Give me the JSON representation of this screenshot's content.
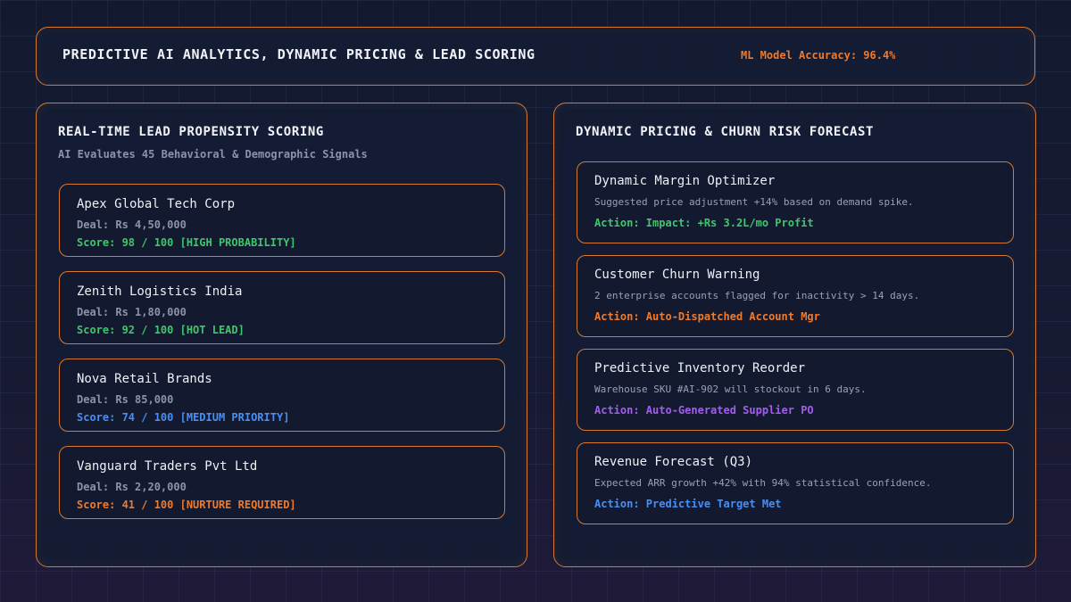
{
  "header": {
    "title": "PREDICTIVE AI ANALYTICS, DYNAMIC PRICING & LEAD SCORING",
    "metric": "ML Model Accuracy: 96.4%",
    "metric_color": "#f07a2a"
  },
  "leads": {
    "title": "REAL-TIME LEAD PROPENSITY SCORING",
    "subtitle": "AI Evaluates 45 Behavioral & Demographic Signals",
    "items": [
      {
        "name": "Apex Global Tech Corp",
        "deal": "Deal: Rs 4,50,000",
        "score": "Score: 98 / 100 [HIGH PROBABILITY]",
        "color": "#3fc66b"
      },
      {
        "name": "Zenith Logistics India",
        "deal": "Deal: Rs 1,80,000",
        "score": "Score: 92 / 100 [HOT LEAD]",
        "color": "#3fc66b"
      },
      {
        "name": "Nova Retail Brands",
        "deal": "Deal: Rs 85,000",
        "score": "Score: 74 / 100 [MEDIUM PRIORITY]",
        "color": "#4a8ef0"
      },
      {
        "name": "Vanguard Traders Pvt Ltd",
        "deal": "Deal: Rs 2,20,000",
        "score": "Score: 41 / 100 [NURTURE REQUIRED]",
        "color": "#f07a2a"
      }
    ]
  },
  "forecast": {
    "title": "DYNAMIC PRICING & CHURN RISK FORECAST",
    "items": [
      {
        "title": "Dynamic Margin Optimizer",
        "desc": "Suggested price adjustment +14% based on demand spike.",
        "action": "Action: Impact: +Rs 3.2L/mo Profit",
        "color": "#3fc66b"
      },
      {
        "title": "Customer Churn Warning",
        "desc": "2 enterprise accounts flagged for inactivity > 14 days.",
        "action": "Action: Auto-Dispatched Account Mgr",
        "color": "#f07a2a"
      },
      {
        "title": "Predictive Inventory Reorder",
        "desc": "Warehouse SKU #AI-902 will stockout in 6 days.",
        "action": "Action: Auto-Generated Supplier PO",
        "color": "#a45cf0"
      },
      {
        "title": "Revenue Forecast (Q3)",
        "desc": "Expected ARR growth +42% with 94% statistical confidence.",
        "action": "Action: Predictive Target Met",
        "color": "#4a8ef0"
      }
    ]
  }
}
